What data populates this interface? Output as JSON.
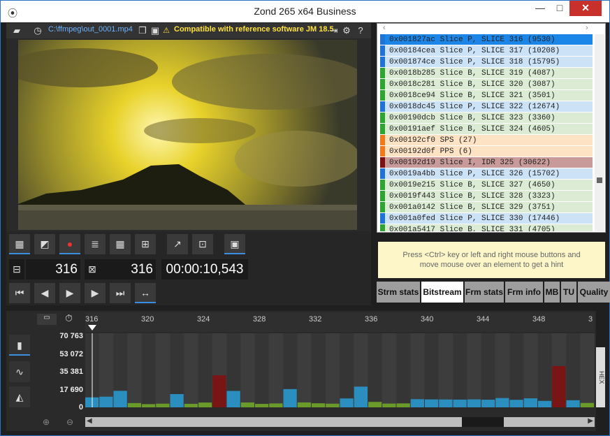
{
  "window": {
    "title": "Zond 265 x64 Business",
    "minimize": "—",
    "maximize": "□",
    "close": "✕"
  },
  "toolbar": {
    "file_path": "C:\\ffmpeg\\out_0001.mp4",
    "compat_text": "Compatible with reference software JM 18.5",
    "icons": [
      "folder-icon",
      "clock-icon",
      "copy-icon",
      "image-icon",
      "warning-icon",
      "export-icon",
      "gear-icon",
      "help-icon"
    ]
  },
  "counters": {
    "frame1": "316",
    "frame2": "316",
    "timecode": "00:00:10,543"
  },
  "bitstream": {
    "rows": [
      {
        "text": "0x001827ac Slice P, SLICE 316 (9530)",
        "type": "P",
        "selected": true
      },
      {
        "text": "0x00184cea Slice P, SLICE 317 (10208)",
        "type": "P"
      },
      {
        "text": "0x001874ce Slice P, SLICE 318 (15795)",
        "type": "P"
      },
      {
        "text": "0x0018b285 Slice B, SLICE 319 (4087)",
        "type": "B"
      },
      {
        "text": "0x0018c281 Slice B, SLICE 320 (3087)",
        "type": "B"
      },
      {
        "text": "0x0018ce94 Slice B, SLICE 321 (3501)",
        "type": "B"
      },
      {
        "text": "0x0018dc45 Slice P, SLICE 322 (12674)",
        "type": "P"
      },
      {
        "text": "0x00190dcb Slice B, SLICE 323 (3360)",
        "type": "B"
      },
      {
        "text": "0x00191aef Slice B, SLICE 324 (4605)",
        "type": "B"
      },
      {
        "text": "0x00192cf0 SPS (27)",
        "type": "SPS"
      },
      {
        "text": "0x00192d0f PPS (6)",
        "type": "SPS"
      },
      {
        "text": "0x00192d19 Slice I, IDR 325 (30622)",
        "type": "I"
      },
      {
        "text": "0x0019a4bb Slice P, SLICE 326 (15702)",
        "type": "P"
      },
      {
        "text": "0x0019e215 Slice B, SLICE 327 (4650)",
        "type": "B"
      },
      {
        "text": "0x0019f443 Slice B, SLICE 328 (3323)",
        "type": "B"
      },
      {
        "text": "0x001a0142 Slice B, SLICE 329 (3751)",
        "type": "B"
      },
      {
        "text": "0x001a0fed Slice P, SLICE 330 (17446)",
        "type": "P"
      },
      {
        "text": "0x001a5417 Slice B, SLICE 331 (4705)",
        "type": "B"
      }
    ]
  },
  "colors": {
    "P_bg": "#cce2f7",
    "P_mark": "#1e73d6",
    "B_bg": "#dcecd4",
    "B_mark": "#2ea52e",
    "SPS_bg": "#fde3c3",
    "SPS_mark": "#f07a1a",
    "I_bg": "#c99a9a",
    "I_mark": "#7a1010",
    "selected_bg": "#1c86e8",
    "bar_P": "#2a8fbf",
    "bar_B": "#6a9a2a",
    "bar_I": "#7a1515"
  },
  "hint": {
    "line1": "Press <Ctrl> key or left and right mouse buttons and",
    "line2": "move mouse over an element to get a hint"
  },
  "tabs": [
    "Strm stats",
    "Bitstream",
    "Frm stats",
    "Frm info",
    "MB",
    "TU",
    "Quality"
  ],
  "hex_label": "HEX",
  "chart_data": {
    "type": "bar",
    "yticks": [
      "70 763",
      "53 072",
      "35 381",
      "17 690",
      "0"
    ],
    "ylim": [
      0,
      70763
    ],
    "xticks": [
      "316",
      "320",
      "324",
      "328",
      "332",
      "336",
      "340",
      "344",
      "348",
      "3"
    ],
    "categories": [
      316,
      317,
      318,
      319,
      320,
      321,
      322,
      323,
      324,
      325,
      326,
      327,
      328,
      329,
      330,
      331,
      332,
      333,
      334,
      335,
      336,
      337,
      338,
      339,
      340,
      341,
      342,
      343,
      344,
      345,
      346,
      347,
      348,
      349,
      350,
      351
    ],
    "values": [
      9530,
      10208,
      15795,
      4087,
      3087,
      3501,
      12674,
      3360,
      4605,
      30622,
      15702,
      4650,
      3323,
      3751,
      17446,
      4705,
      3900,
      3500,
      8500,
      19800,
      5200,
      3600,
      3800,
      7800,
      7600,
      7500,
      7400,
      7600,
      7300,
      8900,
      7200,
      8600,
      6200,
      39500,
      6800,
      4200
    ],
    "frame_types": [
      "P",
      "P",
      "P",
      "B",
      "B",
      "B",
      "P",
      "B",
      "B",
      "I",
      "P",
      "B",
      "B",
      "B",
      "P",
      "B",
      "B",
      "B",
      "P",
      "P",
      "B",
      "B",
      "B",
      "P",
      "P",
      "P",
      "P",
      "P",
      "P",
      "P",
      "P",
      "P",
      "P",
      "I",
      "P",
      "B"
    ]
  }
}
